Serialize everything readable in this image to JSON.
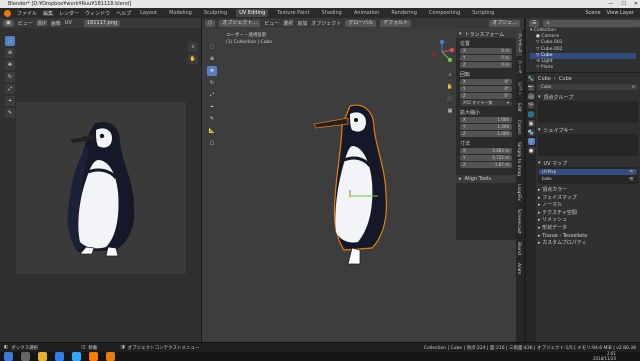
{
  "titlebar": {
    "title": "Blender* [D:¥Dropbox¥work¥Ruu¥181118.blend]",
    "controls": [
      "—",
      "☐",
      "✕"
    ]
  },
  "menubar": {
    "menus": [
      "ファイル",
      "編集",
      "レンダー",
      "ウィンドウ",
      "ヘルプ"
    ],
    "workspaces": [
      "Layout",
      "Modeling",
      "Sculpting",
      "UV Editing",
      "Texture Paint",
      "Shading",
      "Animation",
      "Rendering",
      "Compositing",
      "Scripting"
    ],
    "active_workspace": "UV Editing",
    "scene": "Scene",
    "view_layer": "View Layer"
  },
  "uv_editor": {
    "header_items": [
      "ビュー",
      "選択",
      "画像",
      "UV"
    ],
    "image_name": "181117.png"
  },
  "viewport": {
    "header_items": [
      "オブジェクト...",
      "ビュー",
      "選択",
      "追加",
      "オブジェクト"
    ],
    "orientation": "グローバル",
    "pivot": "デフォルト",
    "view_label": "ユーザー・透視投影",
    "collection_label": "(1) Collection | Cube",
    "overlay_label": "オブジェ..."
  },
  "transform": {
    "title": "トランスフォーム",
    "location_label": "位置",
    "location": [
      "0 m",
      "0 m",
      "0 m"
    ],
    "rotation_label": "回転",
    "rotation": [
      "0°",
      "0°",
      "0°"
    ],
    "rotation_mode": "XYZ オイラー角",
    "scale_label": "拡大縮小",
    "scale": [
      "1.000",
      "1.000",
      "1.000"
    ],
    "dimensions_label": "寸法",
    "dimensions": [
      "0.683 m",
      "0.722 m",
      "1.87 m"
    ],
    "axes": [
      "X",
      "Y",
      "Z"
    ],
    "align_tools": "Align Tools"
  },
  "ntabs": [
    "アイテム",
    "ツール",
    "ビュー",
    "Edit",
    "Camm",
    "Simply to Imag",
    "LoopFix",
    "Screencast",
    "Blend",
    "Anim"
  ],
  "outliner": {
    "items": [
      "Collection",
      "Camera",
      "Cube.001",
      "Cube.002",
      "Cube",
      "Light",
      "Plane"
    ],
    "selected": "Cube"
  },
  "properties": {
    "object_name": "Cube",
    "data_name": "Cube",
    "mesh_name": "Cube",
    "sections": [
      "頂点グループ",
      "シェイプキー",
      "UV マップ"
    ],
    "uv_maps": [
      "UVMap",
      "bake"
    ],
    "collapsed": [
      "頂点カラー",
      "フェイスマップ",
      "ノーマル",
      "テクスチャ空間",
      "リメッシュ",
      "形状データ",
      "Tissue - Tessellate",
      "カスタムプロパティ"
    ]
  },
  "statusbar": {
    "left_items": [
      "ボックス選択",
      "移動",
      "オブジェクトコンテクストメニュー"
    ],
    "right_info": "Collection | Cube | 頂点:224 | 面:216 | 三角面:436 | オブジェクト:1/5 | メモリ:94.6 MiB | v2.80.38",
    "time": "2:01",
    "date": "2018/11/20"
  },
  "colors": {
    "accent": "#5680c2",
    "selection": "#e87d0d",
    "header": "#383838",
    "panel": "#303030"
  }
}
